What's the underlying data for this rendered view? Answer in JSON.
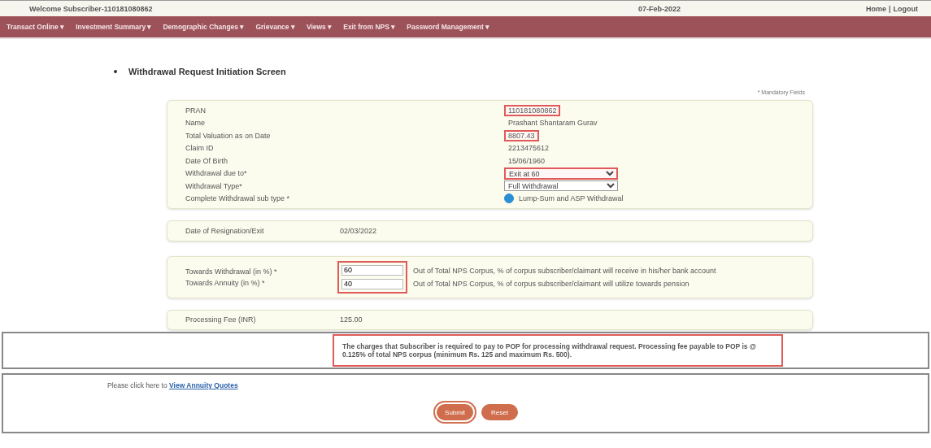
{
  "header": {
    "welcome": "Welcome Subscriber-110181080862",
    "date": "07-Feb-2022",
    "home": "Home",
    "separator": "|",
    "logout": "Logout"
  },
  "menu": [
    {
      "label": "Transact Online",
      "caret": "▾"
    },
    {
      "label": "Investment Summary",
      "caret": "▾"
    },
    {
      "label": "Demographic Changes",
      "caret": "▾"
    },
    {
      "label": "Grievance",
      "caret": "▾"
    },
    {
      "label": "Views",
      "caret": "▾"
    },
    {
      "label": "Exit from NPS",
      "caret": "▾"
    },
    {
      "label": "Password Management",
      "caret": "▾"
    }
  ],
  "heading": "Withdrawal Request Initiation Screen",
  "mandatory_note": "* Mandatory Fields",
  "details": [
    {
      "kind": "text",
      "label": "PRAN",
      "value": "110181080862",
      "highlighted": true
    },
    {
      "kind": "text",
      "label": "Name",
      "value": "Prashant Shantaram Gurav",
      "highlighted": false
    },
    {
      "kind": "text",
      "label": "Total Valuation as on Date",
      "value": "8807.43",
      "highlighted": true
    },
    {
      "kind": "text",
      "label": "Claim ID",
      "value": "2213475612",
      "highlighted": false
    },
    {
      "kind": "text",
      "label": "Date Of Birth",
      "value": "15/06/1960",
      "highlighted": false
    },
    {
      "kind": "select",
      "label": "Withdrawal due to*",
      "value": "Exit at 60",
      "highlighted": true
    },
    {
      "kind": "select",
      "label": "Withdrawal Type*",
      "value": "Full Withdrawal",
      "highlighted": false
    },
    {
      "kind": "radio",
      "label": "Complete Withdrawal sub type *",
      "value": "Lump-Sum and ASP Withdrawal",
      "selected": true,
      "highlighted": false
    }
  ],
  "exit": {
    "label": "Date of Resignation/Exit",
    "value": "02/03/2022"
  },
  "allocation": {
    "highlighted": true,
    "rows": [
      {
        "label": "Towards Withdrawal (in %) *",
        "value": "60",
        "note": "Out of Total NPS Corpus, % of corpus subscriber/claimant will receive in his/her bank account"
      },
      {
        "label": "Towards Annuity (in %) *",
        "value": "40",
        "note": "Out of Total NPS Corpus, % of corpus subscriber/claimant will utilize towards pension"
      }
    ]
  },
  "fee": {
    "label": "Processing Fee (INR)",
    "value": "125.00"
  },
  "fee_note": {
    "text": "The charges that Subscriber is required to pay to POP for processing withdrawal request. Processing fee payable to POP is @ 0.125% of total NPS corpus (minimum Rs. 125 and maximum Rs. 500).",
    "highlighted": true
  },
  "annuity": {
    "prompt": "Please click here to",
    "link": "View Annuity Quotes"
  },
  "buttons": [
    {
      "label": "Submit",
      "highlighted": true
    },
    {
      "label": "Reset",
      "highlighted": false
    }
  ]
}
